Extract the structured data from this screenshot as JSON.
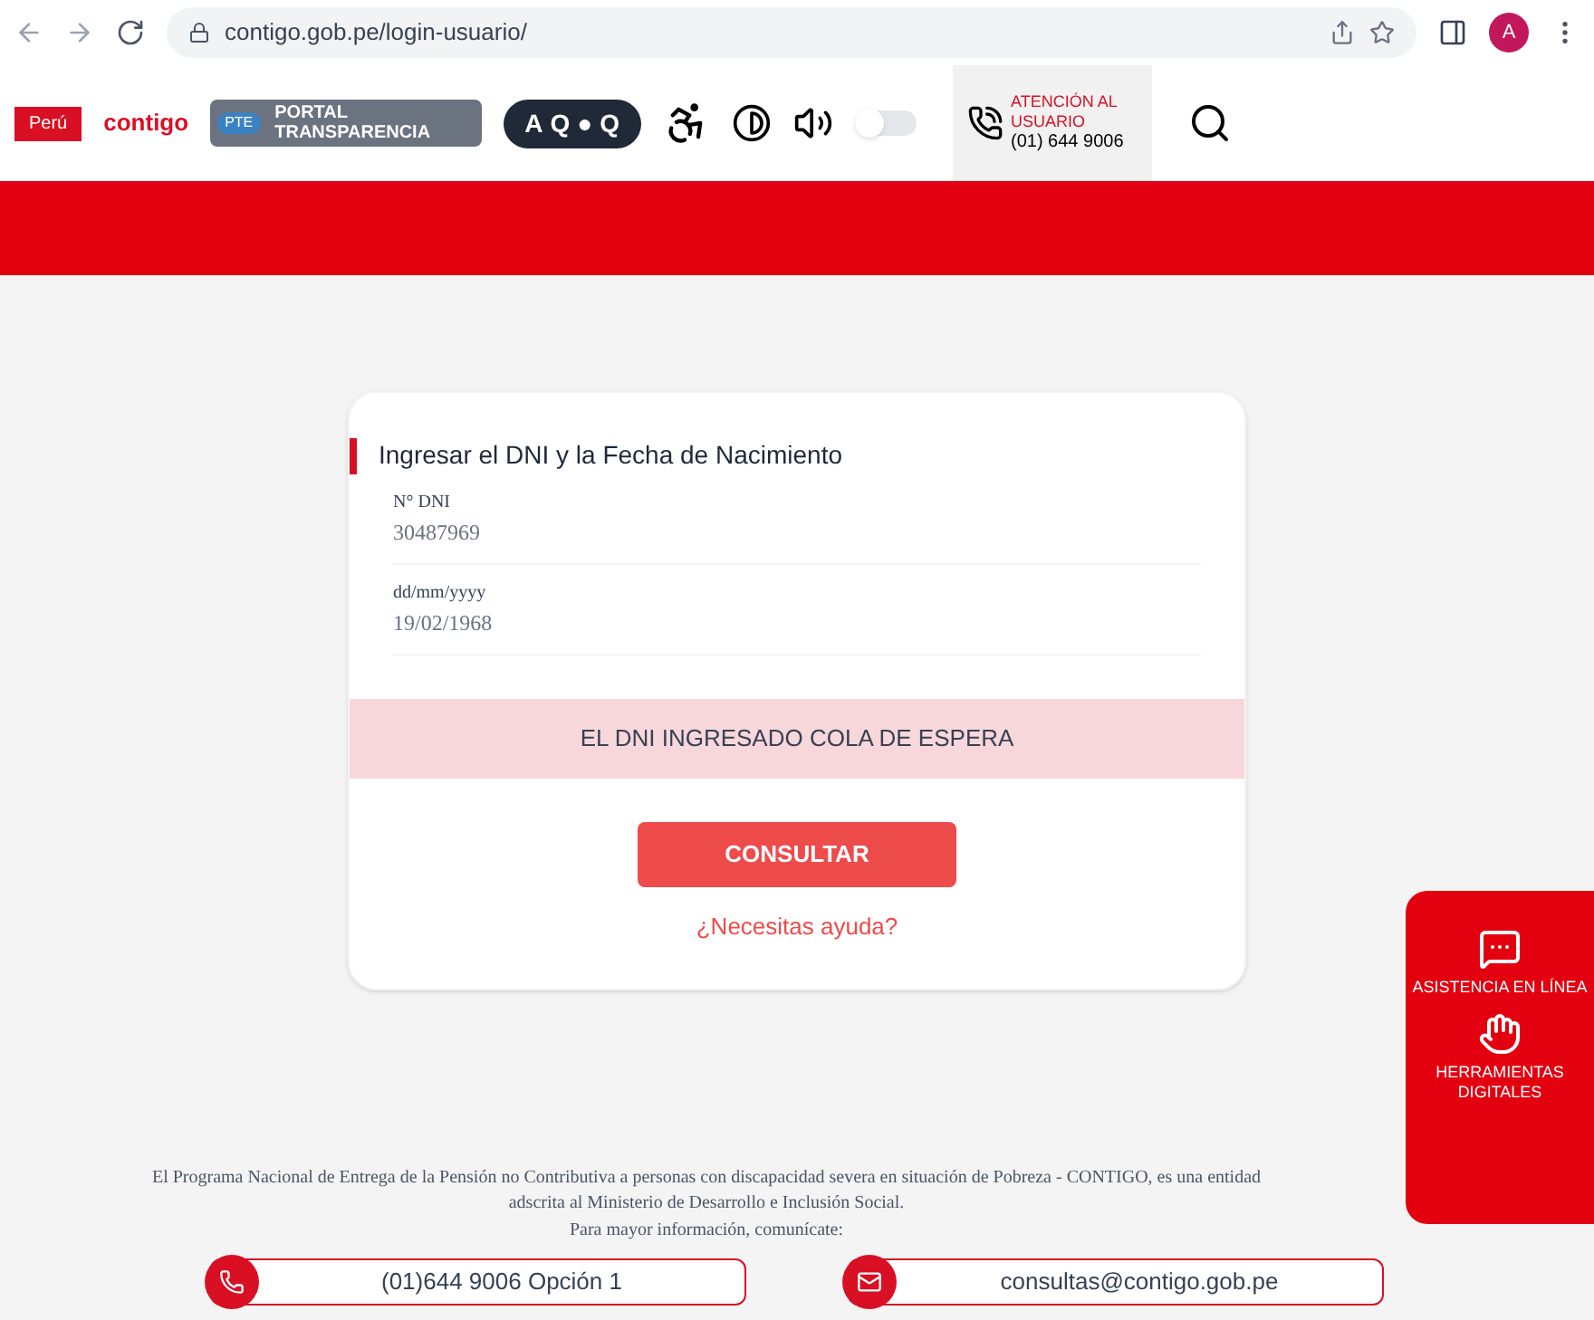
{
  "browser": {
    "url": "contigo.gob.pe/login-usuario/",
    "profile_initial": "A"
  },
  "header": {
    "logo_peru": "Perú",
    "logo_contigo": "contigo",
    "portal_badge": "PTE",
    "portal_text": "PORTAL TRANSPARENCIA",
    "accessibility": [
      "A",
      "Q",
      "●",
      "Q"
    ],
    "sound_on": false,
    "support_title": "ATENCIÓN AL USUARIO",
    "support_phone": "(01) 644 9006"
  },
  "form": {
    "title": "Ingresar el DNI y la Fecha de Nacimiento",
    "fields": [
      {
        "label": "N° DNI",
        "value": "30487969"
      },
      {
        "label": "dd/mm/yyyy",
        "value": "19/02/1968"
      }
    ],
    "alert": "EL DNI INGRESADO COLA DE ESPERA",
    "submit": "CONSULTAR",
    "help_link": "¿Necesitas ayuda?"
  },
  "side_panel": [
    {
      "kind": "chat",
      "label": "ASISTENCIA EN LÍNEA"
    },
    {
      "kind": "tools",
      "label": "HERRAMIENTAS DIGITALES"
    }
  ],
  "footer": {
    "text": "El Programa Nacional de Entrega de la Pensión no Contributiva a personas con discapacidad severa en situación de Pobreza - CONTIGO, es una entidad adscrita al Ministerio de Desarrollo e Inclusión Social.",
    "contact_prompt": "Para mayor información, comunícate:",
    "contacts": [
      {
        "kind": "phone",
        "text": "(01)644 9006 Opción 1"
      },
      {
        "kind": "email",
        "text": "consultas@contigo.gob.pe"
      }
    ]
  }
}
